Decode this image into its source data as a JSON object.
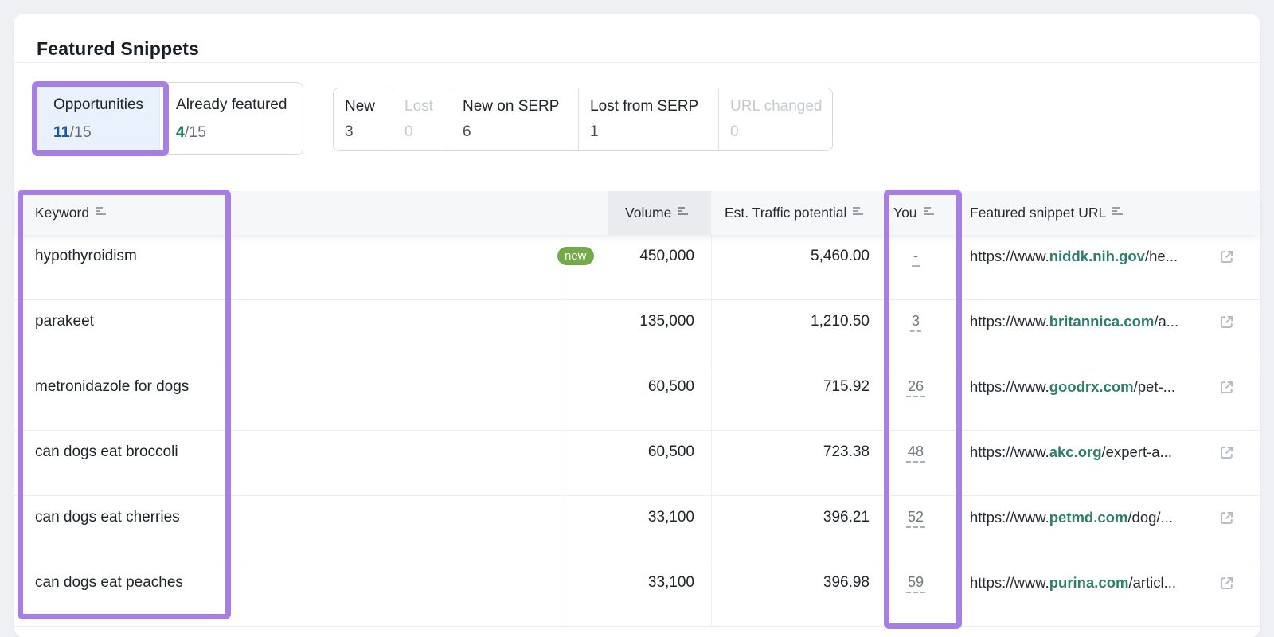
{
  "title": "Featured Snippets",
  "tabs": {
    "opportunities": {
      "label": "Opportunities",
      "count": "11",
      "total": "/15"
    },
    "already_featured": {
      "label": "Already featured",
      "count": "4",
      "total": "/15"
    }
  },
  "filters": {
    "new": {
      "label": "New",
      "count": "3"
    },
    "lost": {
      "label": "Lost",
      "count": "0"
    },
    "new_on_serp": {
      "label": "New on SERP",
      "count": "6"
    },
    "lost_from_serp": {
      "label": "Lost from SERP",
      "count": "1"
    },
    "url_changed": {
      "label": "URL changed",
      "count": "0"
    }
  },
  "table": {
    "headers": {
      "keyword": "Keyword",
      "volume": "Volume",
      "est_traffic": "Est. Traffic potential",
      "you": "You",
      "url": "Featured snippet URL"
    },
    "rows": [
      {
        "keyword": "hypothyroidism",
        "badge": "new",
        "volume": "450,000",
        "est_traffic": "5,460.00",
        "you": "-",
        "url_prefix": "https://www.",
        "url_domain": "niddk.nih.gov",
        "url_path": "/he..."
      },
      {
        "keyword": "parakeet",
        "volume": "135,000",
        "est_traffic": "1,210.50",
        "you": "3",
        "url_prefix": "https://www.",
        "url_domain": "britannica.com",
        "url_path": "/a..."
      },
      {
        "keyword": "metronidazole for dogs",
        "volume": "60,500",
        "est_traffic": "715.92",
        "you": "26",
        "url_prefix": "https://www.",
        "url_domain": "goodrx.com",
        "url_path": "/pet-..."
      },
      {
        "keyword": "can dogs eat broccoli",
        "volume": "60,500",
        "est_traffic": "723.38",
        "you": "48",
        "url_prefix": "https://www.",
        "url_domain": "akc.org",
        "url_path": "/expert-a..."
      },
      {
        "keyword": "can dogs eat cherries",
        "volume": "33,100",
        "est_traffic": "396.21",
        "you": "52",
        "url_prefix": "https://www.",
        "url_domain": "petmd.com",
        "url_path": "/dog/..."
      },
      {
        "keyword": "can dogs eat peaches",
        "volume": "33,100",
        "est_traffic": "396.98",
        "you": "59",
        "url_prefix": "https://www.",
        "url_domain": "purina.com",
        "url_path": "/articl..."
      }
    ]
  },
  "colors": {
    "annotation_purple": "#a77ee3",
    "badge_green": "#74aa49",
    "selected_tab_bg": "#e9f1fd",
    "count_blue": "#1e56ab",
    "count_green": "#1e7d5b",
    "domain_teal": "#2d7f6a",
    "header_bg": "#f6f7f9",
    "sorted_cell_bg": "#e9ebef"
  }
}
